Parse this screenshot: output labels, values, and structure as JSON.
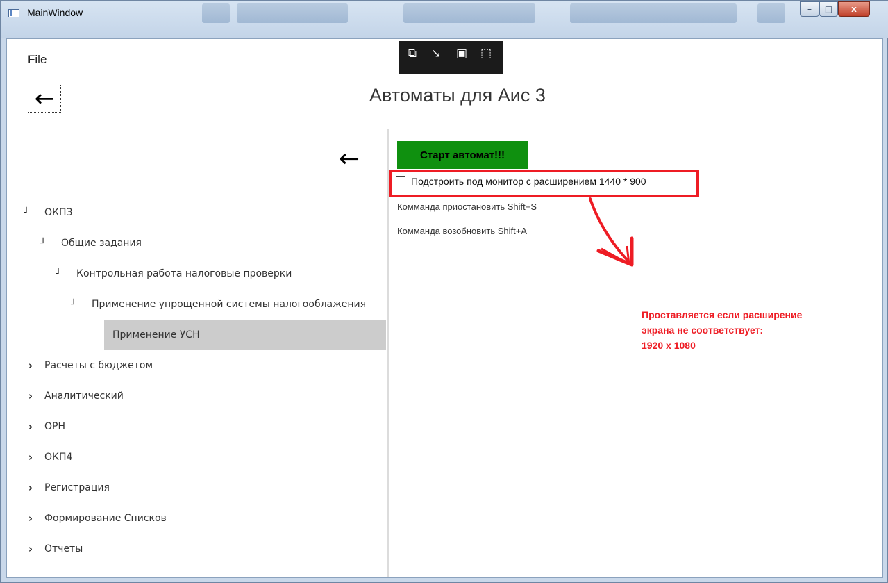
{
  "window": {
    "title": "MainWindow",
    "controls": {
      "minimize": "–",
      "maximize": "□",
      "close": "x"
    }
  },
  "menu": {
    "file": "File"
  },
  "header": {
    "back_icon": "←",
    "title": "Автоматы для Аис 3"
  },
  "debug_toolbar": {
    "icons": [
      "⧉",
      "↘",
      "▣",
      "⬚"
    ]
  },
  "sidebar": {
    "back_icon": "←",
    "tree": [
      {
        "label": "ОКПЗ",
        "level": 0,
        "state": "expanded"
      },
      {
        "label": "Общие задания",
        "level": 1,
        "state": "expanded"
      },
      {
        "label": "Контрольная работа налоговые проверки",
        "level": 2,
        "state": "expanded"
      },
      {
        "label": "Применение упрощенной системы налогооблажения",
        "level": 3,
        "state": "expanded"
      },
      {
        "label": "Применение УСН",
        "level": 4,
        "state": "leaf",
        "selected": true
      },
      {
        "label": "Расчеты с бюджетом",
        "level": 0,
        "state": "collapsed"
      },
      {
        "label": "Аналитический",
        "level": 0,
        "state": "collapsed"
      },
      {
        "label": "ОРН",
        "level": 0,
        "state": "collapsed"
      },
      {
        "label": "ОКП4",
        "level": 0,
        "state": "collapsed"
      },
      {
        "label": "Регистрация",
        "level": 0,
        "state": "collapsed"
      },
      {
        "label": "Формирование Списков",
        "level": 0,
        "state": "collapsed"
      },
      {
        "label": "Отчеты",
        "level": 0,
        "state": "collapsed"
      }
    ]
  },
  "panel": {
    "start_button": "Старт автомат!!!",
    "checkbox_label": "Подстроить под монитор с расширением 1440 * 900",
    "checkbox_checked": false,
    "cmd_pause": "Комманда приостановить Shift+S",
    "cmd_resume": "Комманда возобновить Shift+A",
    "note_lines": [
      "Проставляется если расширение",
      "экрана не соответствует:",
      "1920 x 1080"
    ],
    "accent_color": "#ee1c24",
    "button_color": "#0f900f"
  }
}
